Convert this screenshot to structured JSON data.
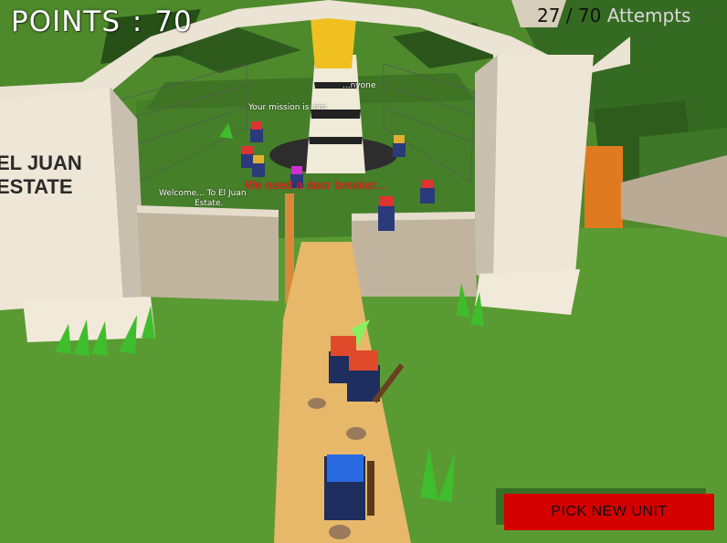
{
  "hud": {
    "points_label": "POINTS",
    "points_separator": ":",
    "points_value": "70",
    "attempts_count": "27 / 70",
    "attempts_label": "Attempts"
  },
  "world": {
    "gate_sign_line1": "EL JUAN",
    "gate_sign_line2": "ESTATE",
    "welcome_line1": "Welcome... To El Juan",
    "welcome_line2": "Estate.",
    "mission_text": "Your mission is sim",
    "far_text": "...nyone",
    "warning_text": "We need a door breaker..."
  },
  "actions": {
    "pick_unit_label": "PICK NEW UNIT"
  }
}
